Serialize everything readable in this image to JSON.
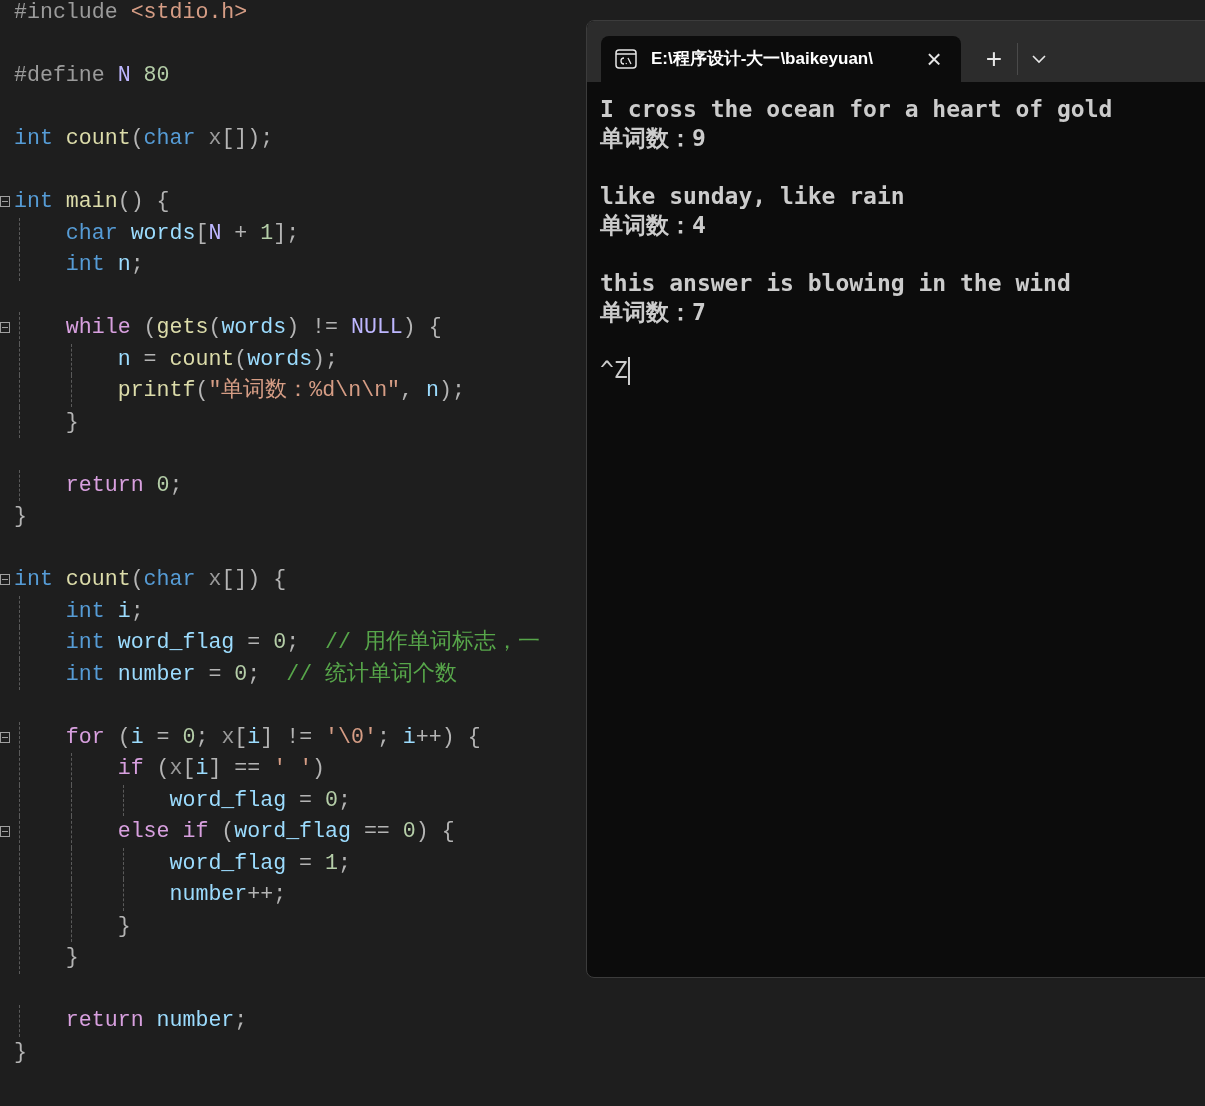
{
  "editor": {
    "blocks": [
      [
        {
          "fold": false,
          "tokens": [
            {
              "t": "#include ",
              "kind": "preproc"
            },
            {
              "t": "<stdio.h>",
              "kind": "string"
            }
          ]
        }
      ],
      [
        {
          "fold": false,
          "tokens": [
            {
              "t": "#define ",
              "kind": "preproc"
            },
            {
              "t": "N ",
              "kind": "macro"
            },
            {
              "t": "80",
              "kind": "number"
            }
          ]
        }
      ],
      [
        {
          "fold": false,
          "tokens": [
            {
              "t": "int ",
              "kind": "keyword"
            },
            {
              "t": "count",
              "kind": "function"
            },
            {
              "t": "(",
              "kind": "punct"
            },
            {
              "t": "char ",
              "kind": "keyword"
            },
            {
              "t": "x",
              "kind": "param"
            },
            {
              "t": "[]);",
              "kind": "punct"
            }
          ]
        }
      ],
      [
        {
          "fold": true,
          "tokens": [
            {
              "t": "int ",
              "kind": "keyword"
            },
            {
              "t": "main",
              "kind": "function"
            },
            {
              "t": "() {",
              "kind": "punct"
            }
          ]
        },
        {
          "fold": false,
          "tokens": [
            {
              "t": "    char ",
              "kind": "keyword"
            },
            {
              "t": "words",
              "kind": "variable"
            },
            {
              "t": "[",
              "kind": "punct"
            },
            {
              "t": "N",
              "kind": "macro"
            },
            {
              "t": " + ",
              "kind": "punct"
            },
            {
              "t": "1",
              "kind": "number"
            },
            {
              "t": "];",
              "kind": "punct"
            }
          ]
        },
        {
          "fold": false,
          "tokens": [
            {
              "t": "    int ",
              "kind": "keyword"
            },
            {
              "t": "n",
              "kind": "variable"
            },
            {
              "t": ";",
              "kind": "punct"
            }
          ]
        }
      ],
      [
        {
          "fold": true,
          "tokens": [
            {
              "t": "    while ",
              "kind": "control"
            },
            {
              "t": "(",
              "kind": "punct"
            },
            {
              "t": "gets",
              "kind": "function"
            },
            {
              "t": "(",
              "kind": "punct"
            },
            {
              "t": "words",
              "kind": "variable"
            },
            {
              "t": ") != ",
              "kind": "punct"
            },
            {
              "t": "NULL",
              "kind": "macro"
            },
            {
              "t": ") {",
              "kind": "punct"
            }
          ]
        },
        {
          "fold": false,
          "tokens": [
            {
              "t": "        n",
              "kind": "variable"
            },
            {
              "t": " = ",
              "kind": "punct"
            },
            {
              "t": "count",
              "kind": "function"
            },
            {
              "t": "(",
              "kind": "punct"
            },
            {
              "t": "words",
              "kind": "variable"
            },
            {
              "t": ");",
              "kind": "punct"
            }
          ]
        },
        {
          "fold": false,
          "tokens": [
            {
              "t": "        printf",
              "kind": "function"
            },
            {
              "t": "(",
              "kind": "punct"
            },
            {
              "t": "\"单词数：%d\\n\\n\"",
              "kind": "string"
            },
            {
              "t": ", ",
              "kind": "punct"
            },
            {
              "t": "n",
              "kind": "variable"
            },
            {
              "t": ");",
              "kind": "punct"
            }
          ]
        },
        {
          "fold": false,
          "tokens": [
            {
              "t": "    }",
              "kind": "punct"
            }
          ]
        }
      ],
      [
        {
          "fold": false,
          "tokens": [
            {
              "t": "    return ",
              "kind": "control"
            },
            {
              "t": "0",
              "kind": "number"
            },
            {
              "t": ";",
              "kind": "punct"
            }
          ]
        },
        {
          "fold": false,
          "tokens": [
            {
              "t": "}",
              "kind": "punct"
            }
          ]
        }
      ],
      [
        {
          "fold": true,
          "tokens": [
            {
              "t": "int ",
              "kind": "keyword"
            },
            {
              "t": "count",
              "kind": "function"
            },
            {
              "t": "(",
              "kind": "punct"
            },
            {
              "t": "char ",
              "kind": "keyword"
            },
            {
              "t": "x",
              "kind": "param"
            },
            {
              "t": "[]) {",
              "kind": "punct"
            }
          ]
        },
        {
          "fold": false,
          "tokens": [
            {
              "t": "    int ",
              "kind": "keyword"
            },
            {
              "t": "i",
              "kind": "variable"
            },
            {
              "t": ";",
              "kind": "punct"
            }
          ]
        },
        {
          "fold": false,
          "tokens": [
            {
              "t": "    int ",
              "kind": "keyword"
            },
            {
              "t": "word_flag",
              "kind": "variable"
            },
            {
              "t": " = ",
              "kind": "punct"
            },
            {
              "t": "0",
              "kind": "number"
            },
            {
              "t": ";  ",
              "kind": "punct"
            },
            {
              "t": "// 用作单词标志，一",
              "kind": "comment"
            }
          ]
        },
        {
          "fold": false,
          "tokens": [
            {
              "t": "    int ",
              "kind": "keyword"
            },
            {
              "t": "number",
              "kind": "variable"
            },
            {
              "t": " = ",
              "kind": "punct"
            },
            {
              "t": "0",
              "kind": "number"
            },
            {
              "t": ";  ",
              "kind": "punct"
            },
            {
              "t": "// 统计单词个数",
              "kind": "comment"
            }
          ]
        }
      ],
      [
        {
          "fold": true,
          "tokens": [
            {
              "t": "    for ",
              "kind": "control"
            },
            {
              "t": "(",
              "kind": "punct"
            },
            {
              "t": "i",
              "kind": "variable"
            },
            {
              "t": " = ",
              "kind": "punct"
            },
            {
              "t": "0",
              "kind": "number"
            },
            {
              "t": "; ",
              "kind": "punct"
            },
            {
              "t": "x",
              "kind": "param"
            },
            {
              "t": "[",
              "kind": "punct"
            },
            {
              "t": "i",
              "kind": "variable"
            },
            {
              "t": "] != ",
              "kind": "punct"
            },
            {
              "t": "'\\0'",
              "kind": "string"
            },
            {
              "t": "; ",
              "kind": "punct"
            },
            {
              "t": "i",
              "kind": "variable"
            },
            {
              "t": "++) {",
              "kind": "punct"
            }
          ]
        },
        {
          "fold": false,
          "tokens": [
            {
              "t": "        if ",
              "kind": "control"
            },
            {
              "t": "(",
              "kind": "punct"
            },
            {
              "t": "x",
              "kind": "param"
            },
            {
              "t": "[",
              "kind": "punct"
            },
            {
              "t": "i",
              "kind": "variable"
            },
            {
              "t": "] == ",
              "kind": "punct"
            },
            {
              "t": "' '",
              "kind": "string"
            },
            {
              "t": ")",
              "kind": "punct"
            }
          ]
        },
        {
          "fold": false,
          "tokens": [
            {
              "t": "            word_flag",
              "kind": "variable"
            },
            {
              "t": " = ",
              "kind": "punct"
            },
            {
              "t": "0",
              "kind": "number"
            },
            {
              "t": ";",
              "kind": "punct"
            }
          ]
        },
        {
          "fold": true,
          "tokens": [
            {
              "t": "        else if ",
              "kind": "control"
            },
            {
              "t": "(",
              "kind": "punct"
            },
            {
              "t": "word_flag",
              "kind": "variable"
            },
            {
              "t": " == ",
              "kind": "punct"
            },
            {
              "t": "0",
              "kind": "number"
            },
            {
              "t": ") {",
              "kind": "punct"
            }
          ]
        },
        {
          "fold": false,
          "tokens": [
            {
              "t": "            word_flag",
              "kind": "variable"
            },
            {
              "t": " = ",
              "kind": "punct"
            },
            {
              "t": "1",
              "kind": "number"
            },
            {
              "t": ";",
              "kind": "punct"
            }
          ]
        },
        {
          "fold": false,
          "tokens": [
            {
              "t": "            number",
              "kind": "variable"
            },
            {
              "t": "++;",
              "kind": "punct"
            }
          ]
        },
        {
          "fold": false,
          "tokens": [
            {
              "t": "        }",
              "kind": "punct"
            }
          ]
        },
        {
          "fold": false,
          "tokens": [
            {
              "t": "    }",
              "kind": "punct"
            }
          ]
        }
      ],
      [
        {
          "fold": false,
          "tokens": [
            {
              "t": "    return ",
              "kind": "control"
            },
            {
              "t": "number",
              "kind": "variable"
            },
            {
              "t": ";",
              "kind": "punct"
            }
          ]
        },
        {
          "fold": false,
          "tokens": [
            {
              "t": "}",
              "kind": "punct"
            }
          ]
        }
      ]
    ]
  },
  "terminal": {
    "tab": {
      "title": "E:\\程序设计-大一\\baikeyuan\\",
      "selected": true,
      "close": "×"
    },
    "new_tab": "+",
    "lines": [
      "I cross the ocean for a heart of gold",
      "单词数：9",
      "like sunday, like rain",
      "单词数：4",
      "this answer is blowing in the wind",
      "单词数：7"
    ],
    "input": "^Z"
  }
}
